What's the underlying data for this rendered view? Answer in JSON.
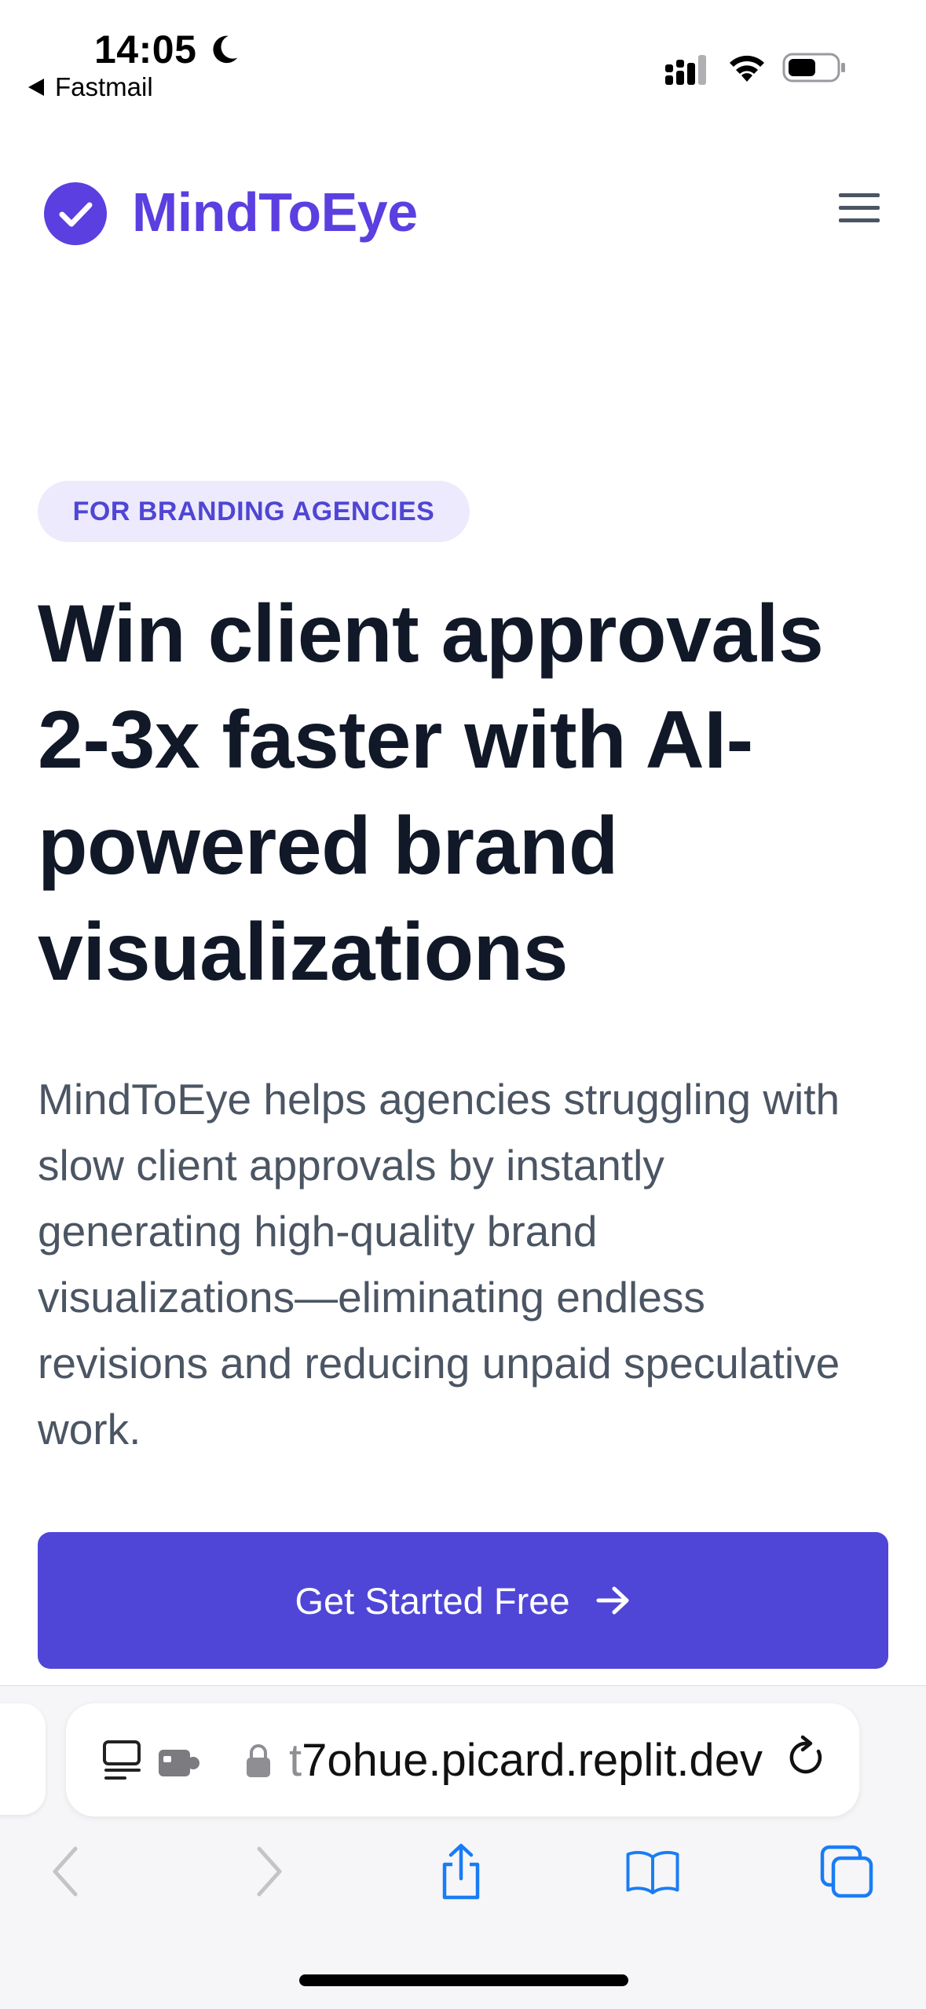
{
  "status_bar": {
    "time": "14:05",
    "back_app": "Fastmail"
  },
  "nav": {
    "brand": "MindToEye",
    "brand_color": "#5b3fe0",
    "logo_icon": "check-circle-icon",
    "menu_icon": "hamburger-menu-icon"
  },
  "hero": {
    "badge": "FOR BRANDING AGENCIES",
    "title": "Win client approvals 2-3x faster with AI-powered brand visualizations",
    "description": "MindToEye helps agencies struggling with slow client approvals by instantly generating high-quality brand visualizations—eliminating endless revisions and reducing unpaid speculative work.",
    "cta_label": "Get Started Free",
    "cta_color": "#4f46d8"
  },
  "browser": {
    "url_prefix": "t",
    "url_rest": "7ohue.picard.replit.dev"
  }
}
